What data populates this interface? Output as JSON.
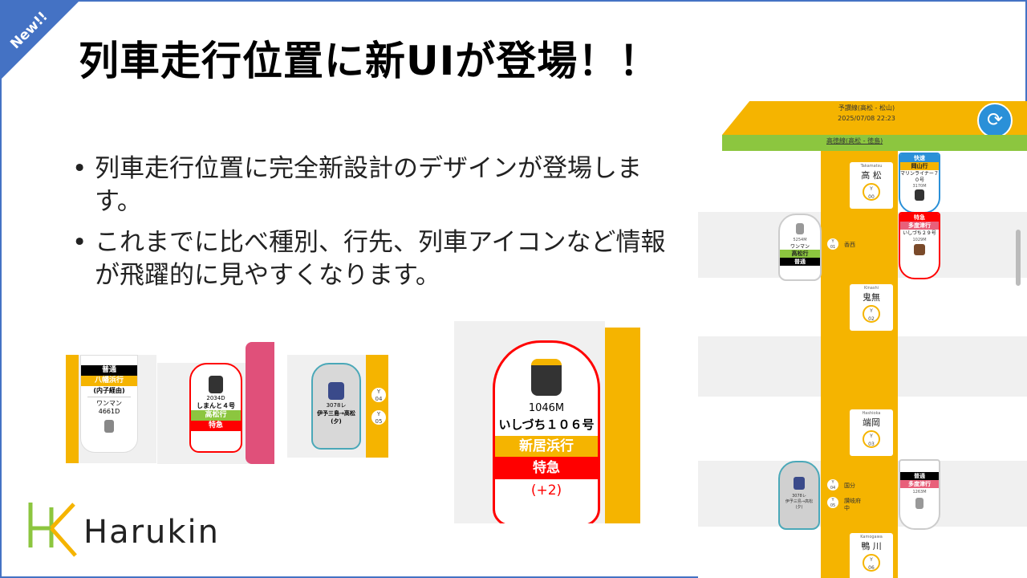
{
  "badge": "New!!",
  "title": "列車走行位置に新UIが登場！！",
  "bullets": [
    "列車走行位置に完全新設計のデザインが登場します。",
    "これまでに比べ種別、行先、列車アイコンなど情報が飛躍的に見やすくなります。"
  ],
  "logo": {
    "text": "Harukin",
    "colors": {
      "green": "#8cc63f",
      "yellow": "#f5b400"
    }
  },
  "colors": {
    "accent": "#4472c4",
    "line": "#f5b400",
    "express": "#ff0000",
    "local": "#000000"
  },
  "screen": {
    "line_name": "予讃線(高松 - 松山)",
    "datetime": "2025/07/08 22:23",
    "branch": "高徳線(高松 - 徳島)",
    "refresh_icon": "refresh-icon",
    "stations": [
      {
        "romaji": "Takamatsu",
        "name": "高 松",
        "code_line": "Y",
        "code_num": "00"
      },
      {
        "romaji": "Kinashi",
        "name": "鬼無",
        "code_line": "Y",
        "code_num": "02"
      },
      {
        "romaji": "Hashioka",
        "name": "端岡",
        "code_line": "Y",
        "code_num": "03"
      },
      {
        "romaji": "Kamogawa",
        "name": "鴨 川",
        "code_line": "Y",
        "code_num": "06"
      }
    ],
    "mini_stations": [
      {
        "code_line": "Y",
        "code_num": "01",
        "name": "香西"
      },
      {
        "code_line": "Y",
        "code_num": "04",
        "name": "国分"
      },
      {
        "code_line": "Y",
        "code_num": "05",
        "name": "讃岐府中"
      }
    ],
    "trains": {
      "marine": {
        "type": "快速",
        "dest": "岡山行",
        "name": "マリンライナー７０号",
        "number": "3170M"
      },
      "ishizuchi": {
        "type": "特急",
        "dest": "多度津行",
        "name": "いしづち２９号",
        "number": "1029M"
      },
      "local_left": {
        "number": "5254M",
        "info": "ワンマン",
        "dest": "高松行",
        "type": "普通"
      },
      "iyo_left": {
        "number": "3078レ",
        "info": "伊予三島→高松",
        "sub": "(夕)"
      },
      "local_right": {
        "type": "普通",
        "dest": "多度津行",
        "number": "1263M"
      }
    }
  },
  "samples": {
    "s1": {
      "type": "普通",
      "dest": "八幡浜行",
      "via": "(内子経由)",
      "info": "ワンマン",
      "number": "4661D"
    },
    "s2": {
      "number": "2034D",
      "name": "しまんと４号",
      "dest": "高松行",
      "type": "特急"
    },
    "s3": {
      "number": "3078レ",
      "info": "伊予三島→高松",
      "sub": "(夕)",
      "codes": [
        {
          "l": "Y",
          "n": "04"
        },
        {
          "l": "Y",
          "n": "05"
        }
      ]
    },
    "s4": {
      "number": "1046M",
      "name": "いしづち１０６号",
      "dest": "新居浜行",
      "type": "特急",
      "delay": "(+2)"
    }
  }
}
